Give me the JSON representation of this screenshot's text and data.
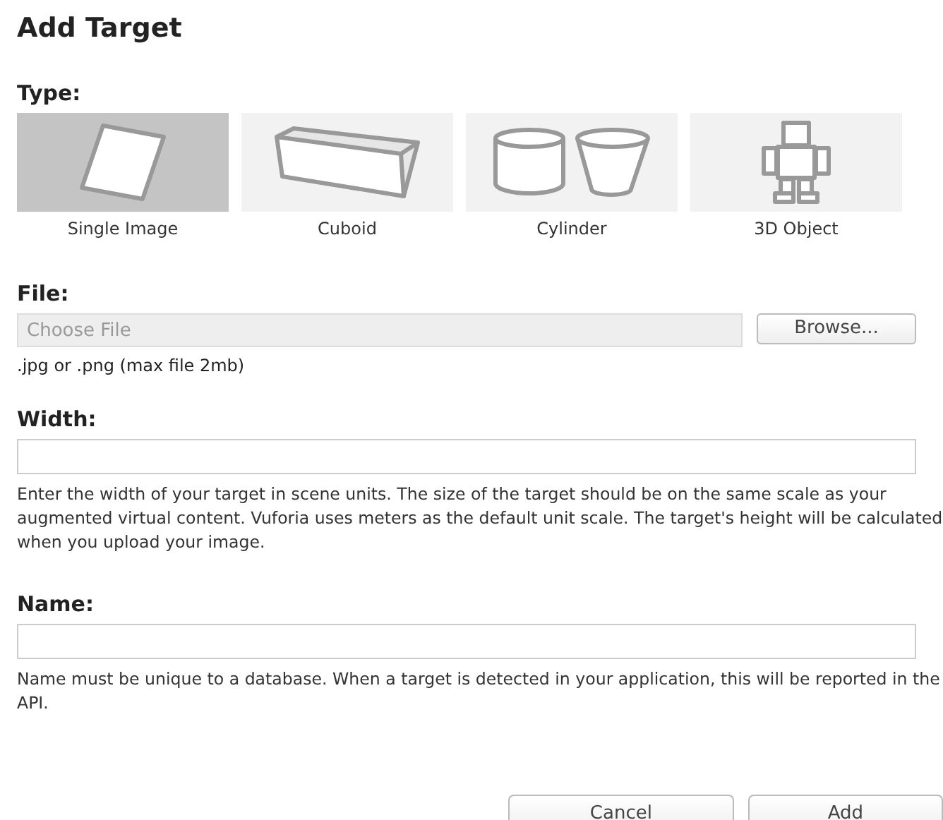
{
  "title": "Add Target",
  "type": {
    "label": "Type:",
    "options": [
      {
        "kind": "image",
        "label": "Single Image",
        "selected": true
      },
      {
        "kind": "cuboid",
        "label": "Cuboid",
        "selected": false
      },
      {
        "kind": "cylinder",
        "label": "Cylinder",
        "selected": false
      },
      {
        "kind": "object",
        "label": "3D Object",
        "selected": false
      }
    ]
  },
  "file": {
    "label": "File:",
    "placeholder": "Choose File",
    "button": "Browse...",
    "hint": ".jpg or .png (max file 2mb)"
  },
  "width": {
    "label": "Width:",
    "help": "Enter the width of your target in scene units. The size of the target should be on the same scale as your augmented virtual content. Vuforia uses meters as the default unit scale. The target's height will be calculated when you upload your image."
  },
  "name": {
    "label": "Name:",
    "help": "Name must be unique to a database. When a target is detected in your application, this will be reported in the API."
  },
  "buttons": [
    "Cancel",
    "Add"
  ]
}
